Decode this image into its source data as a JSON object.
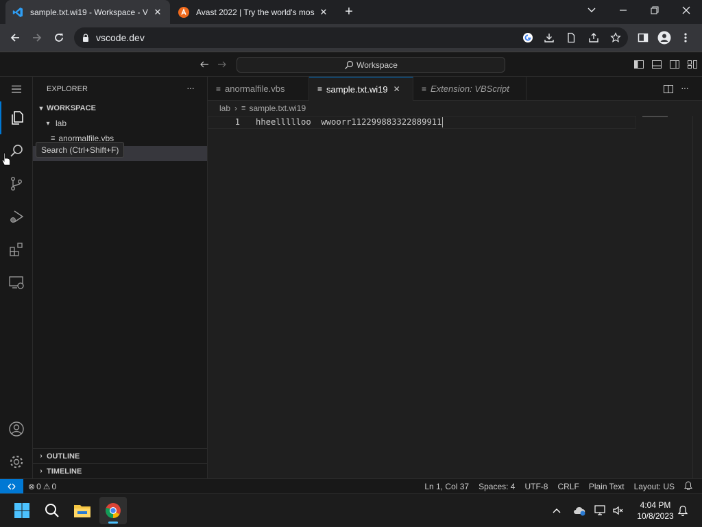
{
  "browser": {
    "tabs": [
      {
        "title": "sample.txt.wi19 - Workspace - V",
        "close": "✕"
      },
      {
        "title": "Avast 2022 | Try the world's mos",
        "close": "✕"
      }
    ],
    "new_tab": "+",
    "url": "vscode.dev"
  },
  "vscode": {
    "command_center": "Workspace",
    "sidebar": {
      "title": "EXPLORER",
      "more": "···",
      "workspace": "WORKSPACE",
      "folder": "lab",
      "file": "anormalfile.vbs",
      "outline": "OUTLINE",
      "timeline": "TIMELINE"
    },
    "tooltip": "Search (Ctrl+Shift+F)",
    "tabs": [
      {
        "label": "anormalfile.vbs"
      },
      {
        "label": "sample.txt.wi19",
        "close": "✕"
      },
      {
        "label": "Extension: VBScript"
      }
    ],
    "more": "···",
    "breadcrumbs": {
      "folder": "lab",
      "file": "sample.txt.wi19"
    },
    "editor": {
      "line_number": "1",
      "line_text": "hheellllloo  wwoorr112299883322889911"
    },
    "status": {
      "errors": "0",
      "warnings": "0",
      "position": "Ln 1, Col 37",
      "spaces": "Spaces: 4",
      "encoding": "UTF-8",
      "eol": "CRLF",
      "language": "Plain Text",
      "layout": "Layout: US"
    }
  },
  "taskbar": {
    "time": "4:04 PM",
    "date": "10/8/2023"
  },
  "colors": {
    "accent": "#0078d4",
    "avast": "#f06a1c"
  }
}
